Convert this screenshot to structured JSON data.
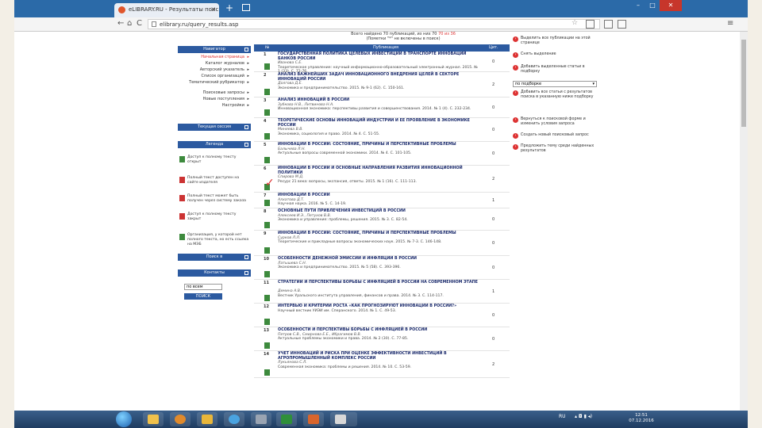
{
  "browser": {
    "tab_title": "eLIBRARY.RU - Результаты поис",
    "tab_close": "×",
    "new_tab": "+",
    "url": "elibrary.ru/query_results.asp",
    "nav_back": "←",
    "nav_forward": "→",
    "nav_reload": "C",
    "nav_home": "⌂",
    "star": "☆",
    "menu": "≡",
    "win_min": "–",
    "win_max": "□",
    "win_close": "✕"
  },
  "sidebar": {
    "navigator_title": "Навигатор",
    "nav_items": [
      {
        "label": "Начальная страница",
        "red": true
      },
      {
        "label": "Каталог журналов",
        "red": false
      },
      {
        "label": "Авторский указатель",
        "red": false
      },
      {
        "label": "Список организаций",
        "red": false
      },
      {
        "label": "Тематический рубрикатор",
        "red": false
      },
      {
        "label": "Поисковые запросы",
        "red": false
      },
      {
        "label": "Новые поступления",
        "red": false
      },
      {
        "label": "Настройки",
        "red": false
      }
    ],
    "session_title": "Текущая сессия",
    "legend_title": "Легенда",
    "legend_items": [
      {
        "label": "Доступ к полному тексту открыт",
        "red": false
      },
      {
        "label": "Полный текст доступен на сайте издателя",
        "red": true
      },
      {
        "label": "Полный текст может быть получен через систему заказа",
        "red": true
      },
      {
        "label": "Доступ к полному тексту закрыт",
        "red": true
      },
      {
        "label": "Организация, у которой нет полного текста, но есть ссылка на МЭБ",
        "red": false
      }
    ],
    "search_title": "Поиск в",
    "feedback_title": "Контакты",
    "select_value": "по всем",
    "select_button": "ПОИСК"
  },
  "results": {
    "header_line1": "Всего найдено 70 публикаций, из них 70",
    "header_red": "70 из 36",
    "header_line2": "(Пометки \"*\" не включены в поиск)",
    "col_num": "№",
    "col_pub": "Публикация",
    "col_cit": "Цит.",
    "items": [
      {
        "n": "1",
        "title": "ГОСУДАРСТВЕННАЯ ПОЛИТИКА ЦЕЛЕВЫХ ИНВЕСТИЦИЙ В ТРАНСПОРТЕ ИННОВАЦИЙ БАНКОВ РОССИИ",
        "auth": "Иванова С.Е.",
        "src": "Теоретическое управление: научный информационно-образовательный электронный журнал. 2015. № 1 (33). С. 72-76.",
        "cit": "0"
      },
      {
        "n": "2",
        "title": "АНАЛИЗ ВАЖНЕЙШИХ ЗАДАЧ ИННОВАЦИОННОГО ВНЕДРЕНИЯ ЦЕЛЕЙ В СЕКТОРЕ ИННОВАЦИЙ РОССИИ",
        "auth": "Долгова Д.Е.",
        "src": "Экономика и предпринимательство. 2015. № 9-1 (62). С. 150-161.",
        "cit": "2"
      },
      {
        "n": "3",
        "title": "АНАЛИЗ ИННОВАЦИЙ В РОССИИ",
        "auth": "Зубкова Н.В., Литвинова Н.А.",
        "src": "Инновационная экономика: перспективы развития и совершенствования. 2014. № 1 (4). С. 232-234.",
        "cit": "0"
      },
      {
        "n": "4",
        "title": "ТЕОРЕТИЧЕСКИЕ ОСНОВЫ ИННОВАЦИЙ ИНДУСТРИИ И ЕЕ ПРОЯВЛЕНИЕ В ЭКОНОМИКЕ РОССИИ",
        "auth": "Минеева В.В.",
        "src": "Экономика, социология и право. 2014. № 4. С. 51-55.",
        "cit": "0"
      },
      {
        "n": "5",
        "title": "ИННОВАЦИИ В РОССИИ: СОСТОЯНИЕ, ПРИЧИНЫ И ПЕРСПЕКТИВНЫЕ ПРОБЛЕМЫ",
        "auth": "Балычева Л.Н.",
        "src": "Актуальные вопросы современной экономики. 2014. № 4. С. 101-105.",
        "cit": "0"
      },
      {
        "n": "6",
        "title": "ИННОВАЦИИ В РОССИИ И ОСНОВНЫЕ НАПРАВЛЕНИЯ РАЗВИТИЯ ИННОВАЦИОННОЙ ПОЛИТИКИ",
        "auth": "Спирова М.Д.",
        "src": "Ресурс 21 века: вопросы, экспансия, ответы. 2015. № 1 (16). С. 111-113.",
        "cit": "2"
      },
      {
        "n": "7",
        "title": "ИННОВАЦИИ В РОССИИ",
        "auth": "Алхатова Д.Т.",
        "src": "Научная наука. 2016. № 5. С. 14-19.",
        "cit": "1"
      },
      {
        "n": "8",
        "title": "ОСНОВНЫЕ ПУТИ ПРИВЛЕЧЕНИЯ ИНВЕСТИЦИЙ В РОССИИ",
        "auth": "Алексеев И.Э., Петухов В.В.",
        "src": "Экономика и управление: проблемы, решения. 2015. № 3. С. 82-54.",
        "cit": "0"
      },
      {
        "n": "9",
        "title": "ИННОВАЦИИ В РОССИИ: СОСТОЯНИЕ, ПРИЧИНЫ И ПЕРСПЕКТИВНЫЕ ПРОБЛЕМЫ",
        "auth": "Сурков Л.Л.",
        "src": "Теоретические и прикладные вопросы экономических наук. 2015. № 7-3. С. 146-148.",
        "cit": "0"
      },
      {
        "n": "10",
        "title": "ОСОБЕННОСТИ ДЕНЕЖНОЙ ЭМИССИИ И ИНФЛЯЦИИ В РОССИИ",
        "auth": "Латышева С.Н.",
        "src": "Экономика и предпринимательство. 2015. № 5 (58). С. 393-396.",
        "cit": "0"
      },
      {
        "n": "11",
        "title": "СТРАТЕГИИ И ПЕРСПЕКТИВЫ БОРЬБЫ С ИНФЛЯЦИЕЙ В РОССИИ НА СОВРЕМЕННОМ ЭТАПЕ",
        "auth": "Демина А.В.",
        "src": "Вестник Уральского института управления, финансов и права. 2014. № 3. С. 114-117.",
        "cit": "1"
      },
      {
        "n": "12",
        "title": "ИНТЕРВЬЮ И КРИТЕРИИ РОСТА «КАК ПРОГНОЗИРУЮТ ИННОВАЦИИ В РОССИИ?»",
        "auth": "",
        "src": "Научный вестник УИЭИ им. Сперанского. 2014. № 1. С. 49-53.",
        "cit": "0"
      },
      {
        "n": "13",
        "title": "ОСОБЕННОСТИ И ПЕРСПЕКТИВЫ БОРЬБЫ С ИНФЛЯЦИЕЙ В РОССИИ",
        "auth": "Петров С.В., Смирнова Е.Е., Ибрагимов В.В.",
        "src": "Актуальные проблемы экономики и права. 2014. № 2 (30). С. 77-85.",
        "cit": "0"
      },
      {
        "n": "14",
        "title": "УЧЕТ ИННОВАЦИЙ И РИСКА ПРИ ОЦЕНКЕ ЭФФЕКТИВНОСТИ ИНВЕСТИЦИЙ В АГРОПРОМЫШЛЕННЫЙ КОМПЛЕКС РОССИИ",
        "auth": "Лукьянова С.Л.",
        "src": "Современная экономика: проблемы и решения. 2014. № 10. С. 53-59.",
        "cit": "2"
      }
    ]
  },
  "right_panel": {
    "actions_top": [
      "Выделить все публикации на этой странице",
      "Снять выделение",
      "Добавить выделенные статьи в подборку"
    ],
    "select_value": "по подборке",
    "select_caret": "▾",
    "actions_mid": [
      "Добавить все статьи с результатов поиска в указанную ниже подборку"
    ],
    "actions_bottom": [
      "Вернуться к поисковой форме и изменить условия запроса",
      "Создать новый поисковый запрос",
      "Предложить тему среди найденных результатов"
    ]
  },
  "taskbar": {
    "lang": "RU",
    "time": "12:51",
    "date": "07.12.2016"
  }
}
